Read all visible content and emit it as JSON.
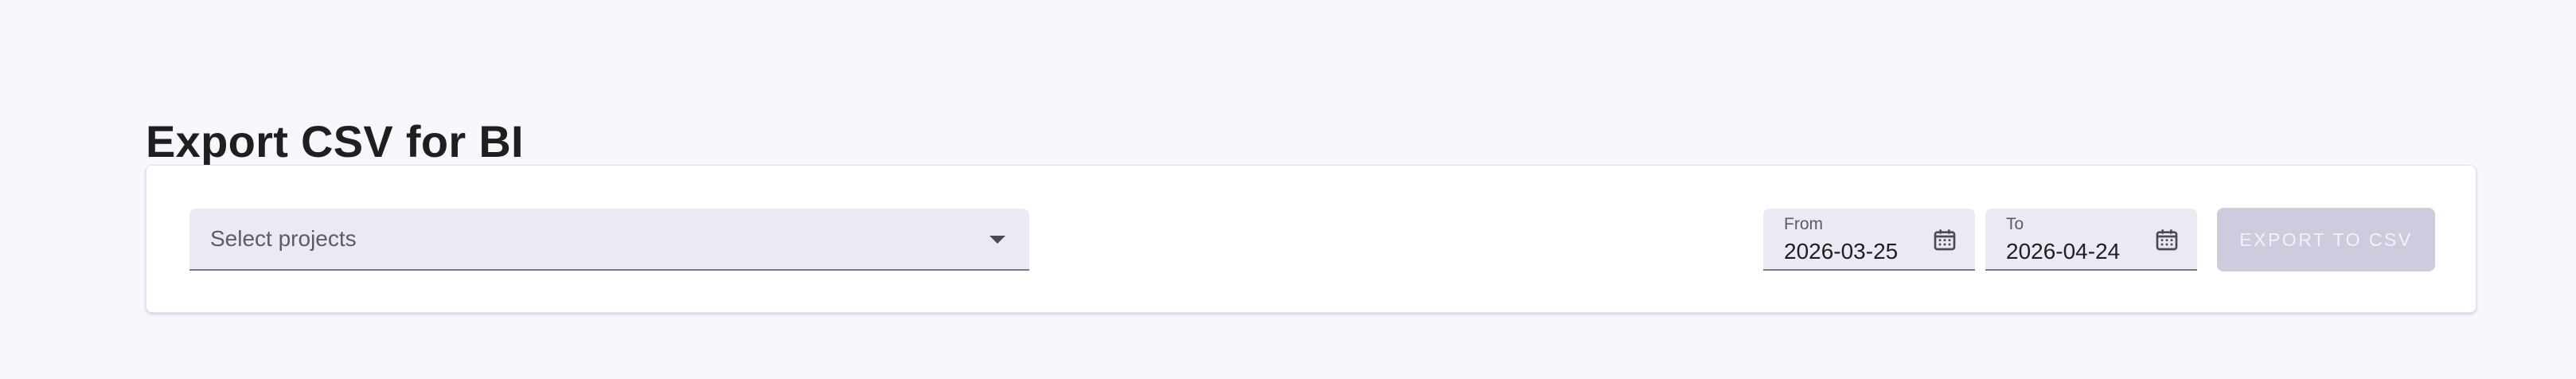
{
  "page": {
    "title": "Export CSV for BI"
  },
  "filters": {
    "projects_select": {
      "placeholder": "Select projects"
    },
    "date_from": {
      "label": "From",
      "value": "2026-03-25"
    },
    "date_to": {
      "label": "To",
      "value": "2026-04-24"
    }
  },
  "actions": {
    "export_label": "EXPORT TO CSV",
    "export_disabled": true
  },
  "colors": {
    "background": "#f8f7fd",
    "field_fill": "#ebe9f4",
    "button_disabled": "#cfcbde"
  }
}
